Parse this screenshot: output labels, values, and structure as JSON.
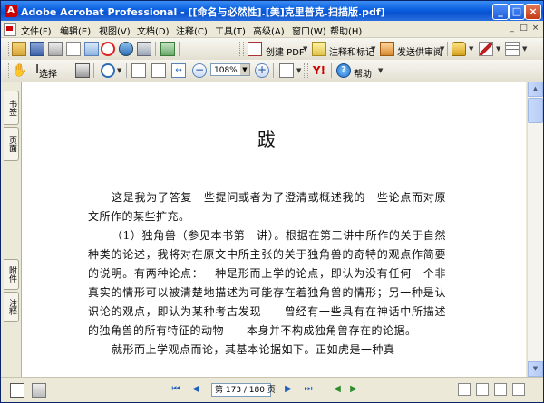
{
  "window": {
    "title": "Adobe Acrobat Professional - [[命名与必然性].[美]克里普克.扫描版.pdf]",
    "minimize_glyph": "_",
    "maximize_glyph": "□",
    "close_glyph": "×"
  },
  "menu": {
    "items": [
      "文件(F)",
      "编辑(E)",
      "视图(V)",
      "文档(D)",
      "注释(C)",
      "工具(T)",
      "高级(A)",
      "窗口(W)",
      "帮助(H)"
    ],
    "mdi_glyphs": [
      "_",
      "□",
      "×"
    ]
  },
  "toolbar1": {
    "create_pdf_label": "创建 PDF",
    "comment_label": "注释和标记",
    "review_label": "发送供审阅"
  },
  "toolbar2": {
    "select_label": "选择",
    "zoom_value": "108%",
    "help_label": "帮助"
  },
  "nav_tabs": [
    "书签",
    "页面",
    "附件",
    "注释"
  ],
  "document": {
    "heading": "跋",
    "paragraphs": [
      "这是我为了答复一些提问或者为了澄清或概述我的一些论点而对原文所作的某些扩充。",
      "（1）独角兽（参见本书第一讲）。根据在第三讲中所作的关于自然种类的论述，我将对在原文中所主张的关于独角兽的奇特的观点作简要的说明。有两种论点：一种是形而上学的论点，即认为没有任何一个非真实的情形可以被清楚地描述为可能存在着独角兽的情形；另一种是认识论的观点，即认为某种考古发现——曾经有一些具有在神话中所描述的独角兽的所有特征的动物——本身并不构成独角兽存在的论据。",
      "就形而上学观点而论，其基本论据如下。正如虎是一种真"
    ]
  },
  "status": {
    "page_display": "第 173 / 180 页"
  }
}
